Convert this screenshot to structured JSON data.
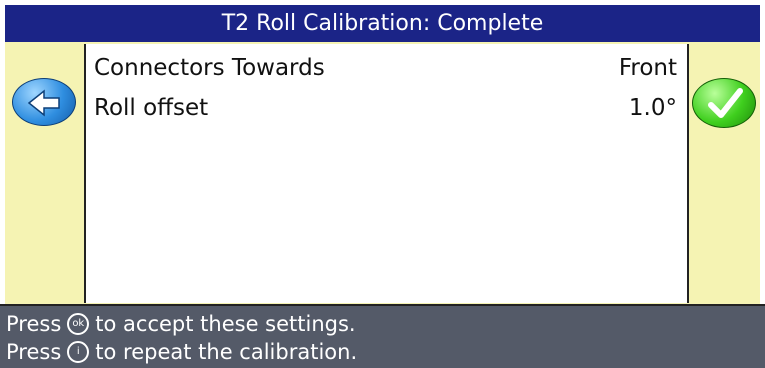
{
  "window": {
    "title": "T2 Roll Calibration: Complete"
  },
  "settings": [
    {
      "label": "Connectors Towards",
      "value": "Front"
    },
    {
      "label": "Roll offset",
      "value": "1.0°"
    }
  ],
  "buttons": {
    "back_icon": "back-arrow-icon",
    "ok_icon": "checkmark-icon"
  },
  "footer": {
    "line1_pre": "Press",
    "line1_symbol": "ok",
    "line1_post": "to accept these settings.",
    "line2_pre": "Press",
    "line2_symbol": "i",
    "line2_post": "to repeat the calibration."
  },
  "colors": {
    "title_bar": "#1b2487",
    "side_panels": "#f5f3b3",
    "footer": "#545a68",
    "back_button": "#2f8ee0",
    "ok_button": "#3fcf1e"
  }
}
